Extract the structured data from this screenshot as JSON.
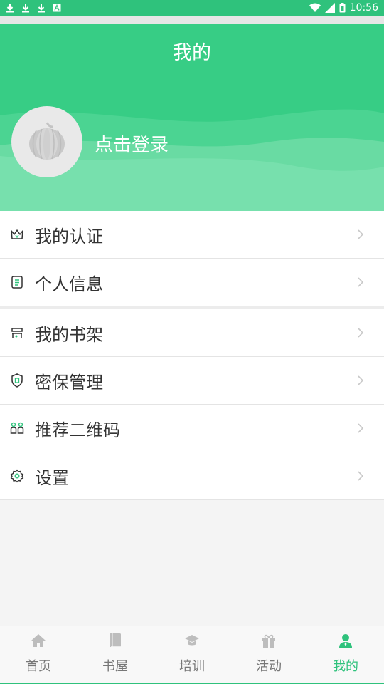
{
  "statusbar": {
    "time": "10:56",
    "left_icons": [
      "download-icon",
      "download-icon",
      "download-icon",
      "text-icon"
    ],
    "right_icons": [
      "wifi-icon",
      "signal-icon",
      "battery-icon"
    ]
  },
  "header": {
    "title": "我的",
    "login_text": "点击登录",
    "avatar_icon": "pumpkin-icon"
  },
  "menu": {
    "items": [
      {
        "label": "我的认证",
        "icon": "crown-icon"
      },
      {
        "label": "个人信息",
        "icon": "document-icon"
      },
      {
        "label": "我的书架",
        "icon": "bookshelf-icon"
      },
      {
        "label": "密保管理",
        "icon": "shield-icon"
      },
      {
        "label": "推荐二维码",
        "icon": "people-icon"
      },
      {
        "label": "设置",
        "icon": "gear-icon"
      }
    ]
  },
  "bottom_nav": {
    "tabs": [
      {
        "label": "首页",
        "icon": "home-icon",
        "active": false
      },
      {
        "label": "书屋",
        "icon": "book-icon",
        "active": false
      },
      {
        "label": "培训",
        "icon": "graduation-cap-icon",
        "active": false
      },
      {
        "label": "活动",
        "icon": "gift-icon",
        "active": false
      },
      {
        "label": "我的",
        "icon": "user-icon",
        "active": true
      }
    ]
  },
  "colors": {
    "accent": "#2fc27c",
    "header_bg": "#37cd85",
    "inactive_tab": "#777777"
  }
}
